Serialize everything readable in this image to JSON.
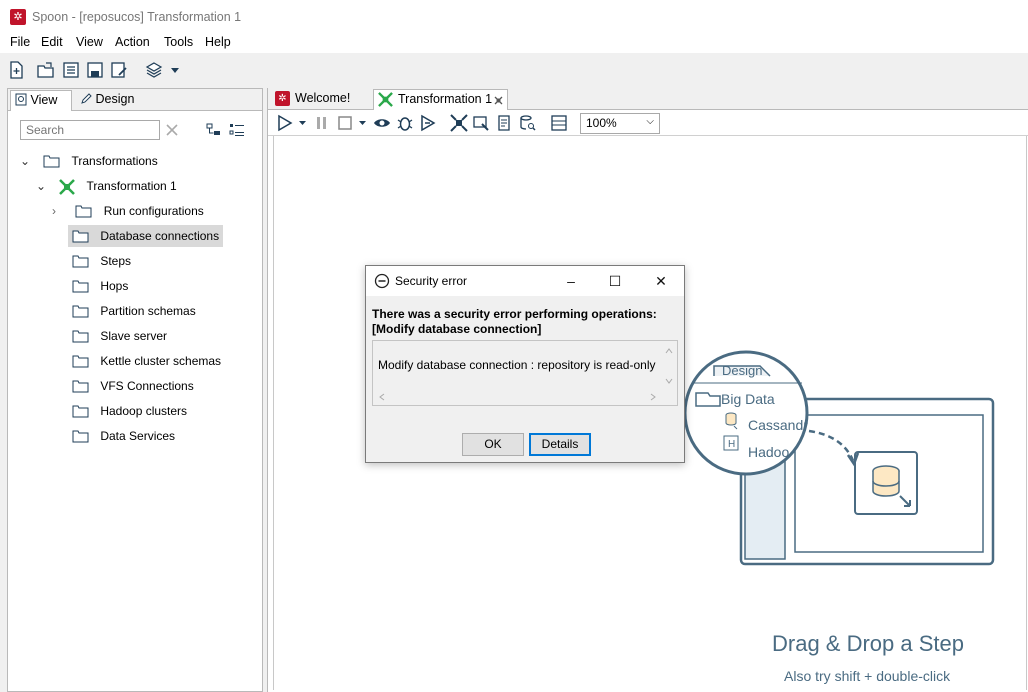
{
  "window": {
    "title": "Spoon - [reposucos] Transformation 1",
    "app_icon": "spoon-app-icon"
  },
  "menu": [
    "File",
    "Edit",
    "View",
    "Action",
    "Tools",
    "Help"
  ],
  "left_panel": {
    "tabs": [
      {
        "label": "View",
        "icon": "search-icon"
      },
      {
        "label": "Design",
        "icon": "pencil-icon"
      }
    ],
    "search_placeholder": "Search",
    "tree": {
      "root": "Transformations",
      "transformation": "Transformation 1",
      "items": [
        "Run configurations",
        "Database connections",
        "Steps",
        "Hops",
        "Partition schemas",
        "Slave server",
        "Kettle cluster schemas",
        "VFS Connections",
        "Hadoop clusters",
        "Data Services"
      ],
      "selected": "Database connections"
    }
  },
  "editor": {
    "tabs": [
      {
        "label": "Welcome!"
      },
      {
        "label": "Transformation 1"
      }
    ],
    "zoom": "100%"
  },
  "canvas_hint": {
    "panel_tab": "Design",
    "folder": "Big Data",
    "item1": "Cassandr",
    "item2": "Hadoo",
    "title": "Drag & Drop a Step",
    "subtitle": "Also try shift + double-click"
  },
  "dialog": {
    "title": "Security error",
    "message_line1": "There was a security error performing operations:",
    "message_line2": "[Modify database connection]",
    "detail": "Modify database connection : repository is read-only",
    "ok": "OK",
    "details": "Details"
  },
  "colors": {
    "accent": "#0078d7",
    "hint": "#4a6b82",
    "brand": "#c0142b"
  }
}
